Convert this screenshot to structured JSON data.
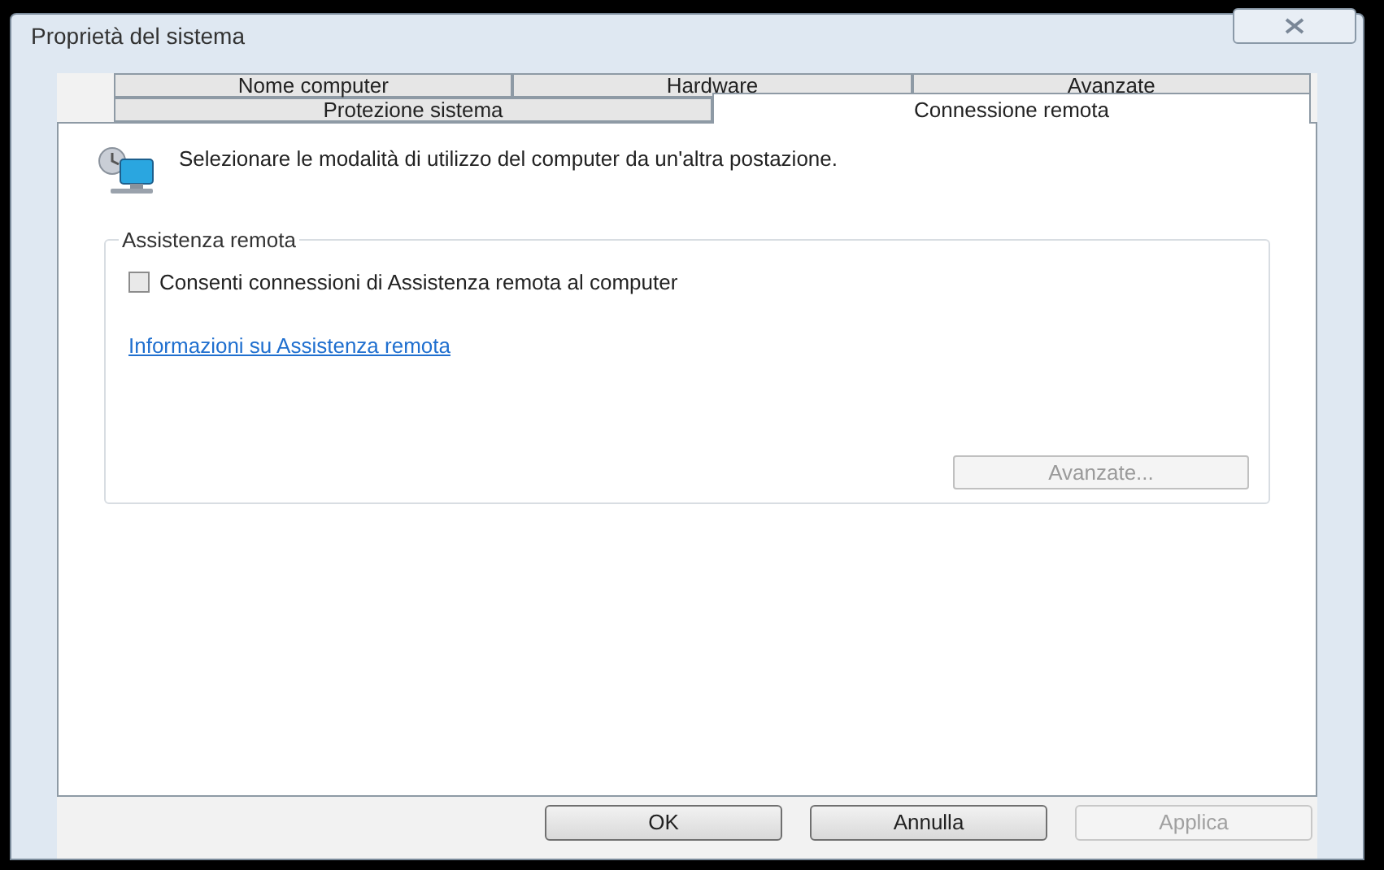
{
  "window": {
    "title": "Proprietà del sistema"
  },
  "tab_rows": [
    [
      {
        "label": "Nome computer",
        "selected": false
      },
      {
        "label": "Hardware",
        "selected": false
      },
      {
        "label": "Avanzate",
        "selected": false
      }
    ],
    [
      {
        "label": "Protezione sistema",
        "selected": false
      },
      {
        "label": "Connessione remota",
        "selected": true
      }
    ]
  ],
  "description": "Selezionare le modalità di utilizzo del computer da un'altra postazione.",
  "group": {
    "title": "Assistenza remota",
    "checkbox": {
      "label": "Consenti connessioni di Assistenza remota al computer",
      "checked": false
    },
    "link": "Informazioni su Assistenza remota",
    "button": {
      "label": "Avanzate...",
      "disabled": true
    }
  },
  "buttons": [
    {
      "label": "OK",
      "disabled": false
    },
    {
      "label": "Annulla",
      "disabled": false
    },
    {
      "label": "Applica",
      "disabled": true
    }
  ]
}
